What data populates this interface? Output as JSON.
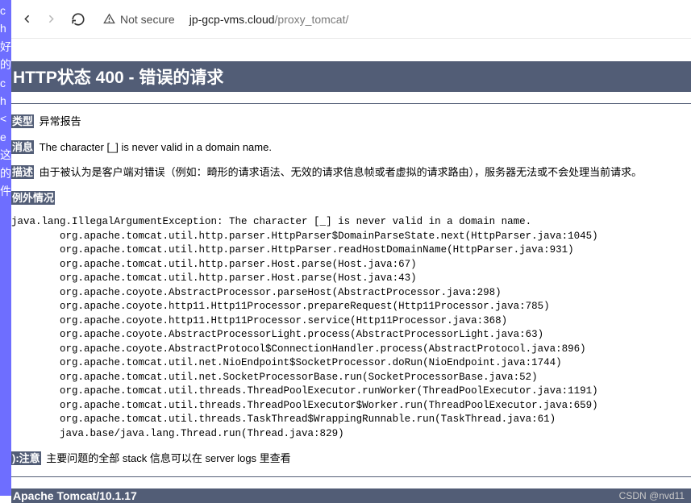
{
  "left_strip_chars": "c\nh\n好\n的\nc\nh\n<\ne\n\n\n\n\n\n\n\n\n\n\n这\n的\n\n\n件\n",
  "browser": {
    "security_label": "Not secure",
    "url_domain": "jp-gcp-vms.cloud",
    "url_path": "/proxy_tomcat/"
  },
  "page": {
    "status_header": "HTTP状态 400 - 错误的请求",
    "labels": {
      "type": "类型",
      "message": "消息",
      "description": "描述",
      "exception": "例外情况",
      "note": "):注意"
    },
    "type_text": "异常报告",
    "message_text": "The character [_] is never valid in a domain name.",
    "description_text": "由于被认为是客户端对错误（例如：畸形的请求语法、无效的请求信息帧或者虚拟的请求路由），服务器无法或不会处理当前请求。",
    "note_text": "主要问题的全部 stack 信息可以在 server logs 里查看",
    "footer": "Apache Tomcat/10.1.17"
  },
  "exception_lines": [
    "java.lang.IllegalArgumentException: The character [_] is never valid in a domain name.",
    "        org.apache.tomcat.util.http.parser.HttpParser$DomainParseState.next(HttpParser.java:1045)",
    "        org.apache.tomcat.util.http.parser.HttpParser.readHostDomainName(HttpParser.java:931)",
    "        org.apache.tomcat.util.http.parser.Host.parse(Host.java:67)",
    "        org.apache.tomcat.util.http.parser.Host.parse(Host.java:43)",
    "        org.apache.coyote.AbstractProcessor.parseHost(AbstractProcessor.java:298)",
    "        org.apache.coyote.http11.Http11Processor.prepareRequest(Http11Processor.java:785)",
    "        org.apache.coyote.http11.Http11Processor.service(Http11Processor.java:368)",
    "        org.apache.coyote.AbstractProcessorLight.process(AbstractProcessorLight.java:63)",
    "        org.apache.coyote.AbstractProtocol$ConnectionHandler.process(AbstractProtocol.java:896)",
    "        org.apache.tomcat.util.net.NioEndpoint$SocketProcessor.doRun(NioEndpoint.java:1744)",
    "        org.apache.tomcat.util.net.SocketProcessorBase.run(SocketProcessorBase.java:52)",
    "        org.apache.tomcat.util.threads.ThreadPoolExecutor.runWorker(ThreadPoolExecutor.java:1191)",
    "        org.apache.tomcat.util.threads.ThreadPoolExecutor$Worker.run(ThreadPoolExecutor.java:659)",
    "        org.apache.tomcat.util.threads.TaskThread$WrappingRunnable.run(TaskThread.java:61)",
    "        java.base/java.lang.Thread.run(Thread.java:829)"
  ],
  "watermark": "CSDN @nvd11"
}
